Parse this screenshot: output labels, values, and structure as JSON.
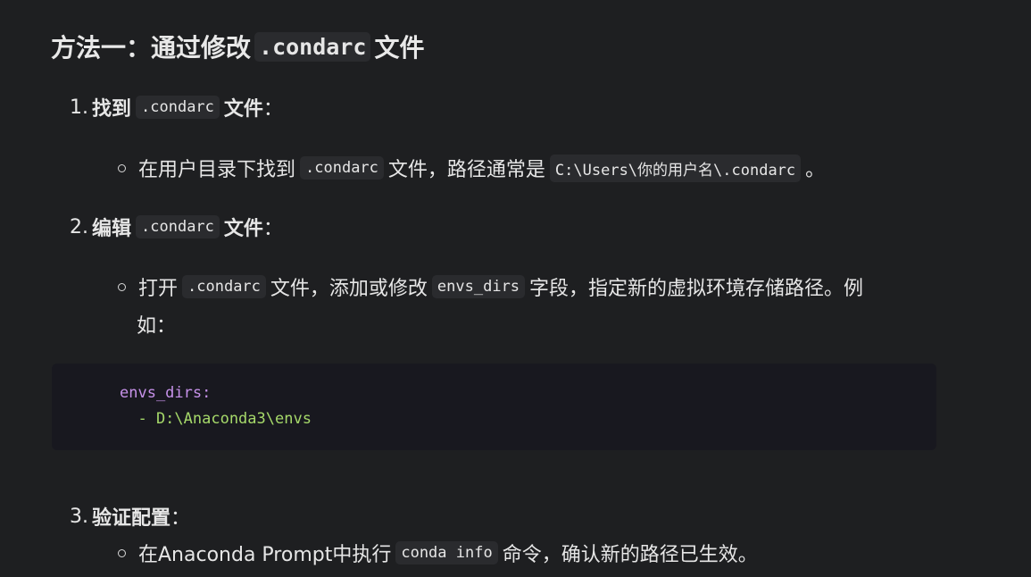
{
  "heading": {
    "prefix": "方法一：通过修改",
    "code": ".condarc",
    "suffix": "文件"
  },
  "steps": [
    {
      "number": "1.",
      "title_before": "找到",
      "title_code": ".condarc",
      "title_after": "文件",
      "colon": "：",
      "bullets": [
        {
          "text1": "在用户目录下找到",
          "code1": ".condarc",
          "text2": "文件，路径通常是",
          "code2": "C:\\Users\\你的用户名\\.condarc",
          "text3": "。"
        }
      ]
    },
    {
      "number": "2.",
      "title_before": "编辑",
      "title_code": ".condarc",
      "title_after": "文件",
      "colon": "：",
      "bullets": [
        {
          "text1": "打开",
          "code1": ".condarc",
          "text2": "文件，添加或修改",
          "code2": "envs_dirs",
          "text3": "字段，指定新的虚拟环境存储路径。例",
          "text4": "如："
        }
      ]
    },
    {
      "number": "3.",
      "title_before": "验证配置",
      "colon": "：",
      "bullets": [
        {
          "text1": "在Anaconda Prompt中执行",
          "code1": "conda info",
          "text2": "命令，确认新的路径已生效。"
        }
      ]
    }
  ],
  "code_block": {
    "line1": "envs_dirs:",
    "line2": "  - D:\\Anaconda3\\envs"
  },
  "colors": {
    "background": "#1e1f21",
    "code_block_bg": "#18181f",
    "yaml_key": "#c792ea",
    "yaml_value": "#a6d96a"
  }
}
